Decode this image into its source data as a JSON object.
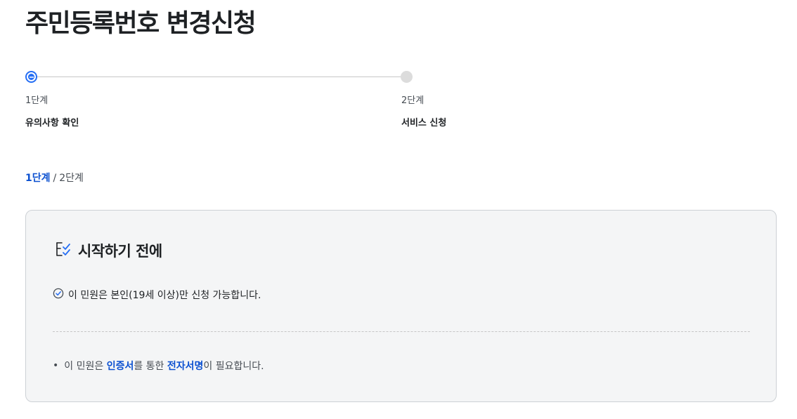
{
  "page": {
    "title": "주민등록번호 변경신청"
  },
  "stepper": {
    "steps": [
      {
        "number": "1단계",
        "label": "유의사항 확인",
        "state": "active"
      },
      {
        "number": "2단계",
        "label": "서비스 신청",
        "state": "inactive"
      }
    ]
  },
  "progress": {
    "current": "1단계",
    "separator": "/",
    "total": "2단계"
  },
  "notice": {
    "title": "시작하기 전에",
    "title_icon": "checklist-icon",
    "check_icon": "check-circle-icon",
    "check_text": "이 민원은 본인(19세 이상)만 신청 가능합니다.",
    "bullet": "•",
    "bullet_parts": {
      "p1": "이 민원은 ",
      "h1": "인증서",
      "p2": "를 통한 ",
      "h2": "전자서명",
      "p3": "이 필요합니다."
    }
  },
  "colors": {
    "accent": "#256ef4",
    "link": "#0b50d0",
    "card_bg": "#f4f5f6",
    "inactive_dot": "#dcdcdc"
  }
}
